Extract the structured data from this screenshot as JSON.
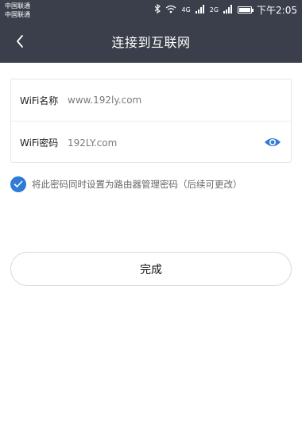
{
  "status_bar": {
    "carrier_1": "中国联通",
    "carrier_2": "中国联通",
    "network_1": "4G",
    "network_2": "2G",
    "time": "下午2:05",
    "icons": [
      "bluetooth-icon",
      "wifi-icon",
      "signal-icon",
      "signal-icon",
      "battery-icon"
    ]
  },
  "header": {
    "title": "连接到互联网",
    "back_icon": "chevron-left-icon"
  },
  "form": {
    "wifi_name_label": "WiFi名称",
    "wifi_name_value": "www.192ly.com",
    "wifi_password_label": "WiFi密码",
    "wifi_password_value": "192LY.com",
    "password_toggle_icon": "eye-icon"
  },
  "option": {
    "checked": true,
    "label": "将此密码同时设置为路由器管理密码（后续可更改）"
  },
  "actions": {
    "done_label": "完成"
  },
  "colors": {
    "header_bg": "#3a3f4b",
    "accent": "#2f7bd8"
  }
}
